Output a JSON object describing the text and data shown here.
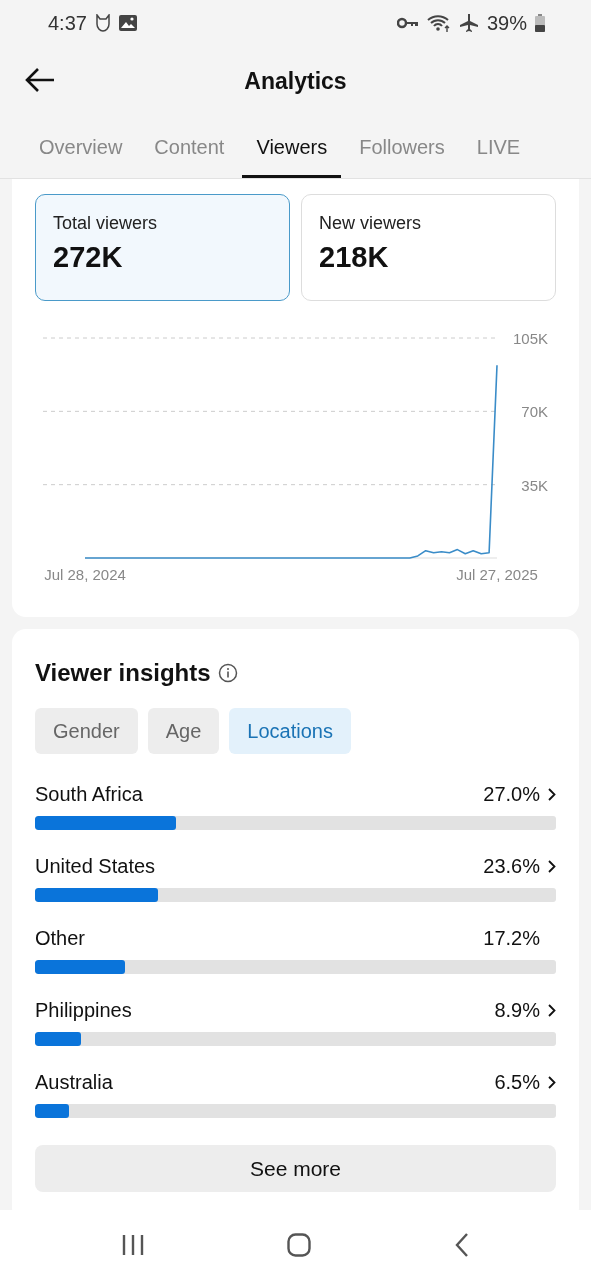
{
  "status_bar": {
    "time": "4:37",
    "battery": "39%"
  },
  "header": {
    "title": "Analytics"
  },
  "tabs": [
    {
      "label": "Overview",
      "selected": false
    },
    {
      "label": "Content",
      "selected": false
    },
    {
      "label": "Viewers",
      "selected": true
    },
    {
      "label": "Followers",
      "selected": false
    },
    {
      "label": "LIVE",
      "selected": false
    }
  ],
  "metrics": [
    {
      "label": "Total viewers",
      "value": "272K",
      "selected": true
    },
    {
      "label": "New viewers",
      "value": "218K",
      "selected": false
    }
  ],
  "chart_data": {
    "type": "line",
    "categories": [
      "Jul 28, 2024",
      null,
      null,
      null,
      null,
      null,
      null,
      null,
      null,
      null,
      null,
      null,
      null,
      null,
      null,
      null,
      null,
      null,
      null,
      null,
      null,
      null,
      null,
      null,
      null,
      null,
      null,
      null,
      null,
      null,
      null,
      null,
      null,
      null,
      null,
      null,
      null,
      null,
      null,
      null,
      null,
      null,
      null,
      null,
      null,
      null,
      null,
      null,
      null,
      null,
      null,
      null,
      "Jul 27, 2025"
    ],
    "series": [
      {
        "color": "#3a8cc8",
        "values": [
          0,
          0,
          0,
          0,
          0,
          0,
          0,
          0,
          0,
          0,
          0,
          0,
          0,
          0,
          0,
          0,
          0,
          0,
          0,
          0,
          0,
          0,
          0,
          0,
          0,
          0,
          0,
          0,
          0,
          0,
          0,
          0,
          0,
          0,
          0,
          0,
          0,
          0,
          0,
          0,
          0,
          0,
          1000,
          3500,
          2500,
          3000,
          2500,
          4000,
          2000,
          3500,
          2000,
          2500,
          92000
        ]
      }
    ],
    "yticks": [
      {
        "value": 35000,
        "label": "35K"
      },
      {
        "value": 70000,
        "label": "70K"
      },
      {
        "value": 105000,
        "label": "105K"
      }
    ],
    "ylim": [
      0,
      105000
    ]
  },
  "insights": {
    "title": "Viewer insights",
    "filters": [
      {
        "label": "Gender",
        "selected": false
      },
      {
        "label": "Age",
        "selected": false
      },
      {
        "label": "Locations",
        "selected": true
      }
    ],
    "locations": [
      {
        "name": "South Africa",
        "share": "27.0%",
        "level": 0.27,
        "has_detail": true
      },
      {
        "name": "United States",
        "share": "23.6%",
        "level": 0.236,
        "has_detail": true
      },
      {
        "name": "Other",
        "share": "17.2%",
        "level": 0.172,
        "has_detail": false
      },
      {
        "name": "Philippines",
        "share": "8.9%",
        "level": 0.089,
        "has_detail": true
      },
      {
        "name": "Australia",
        "share": "6.5%",
        "level": 0.065,
        "has_detail": true
      }
    ],
    "button": "See more"
  }
}
